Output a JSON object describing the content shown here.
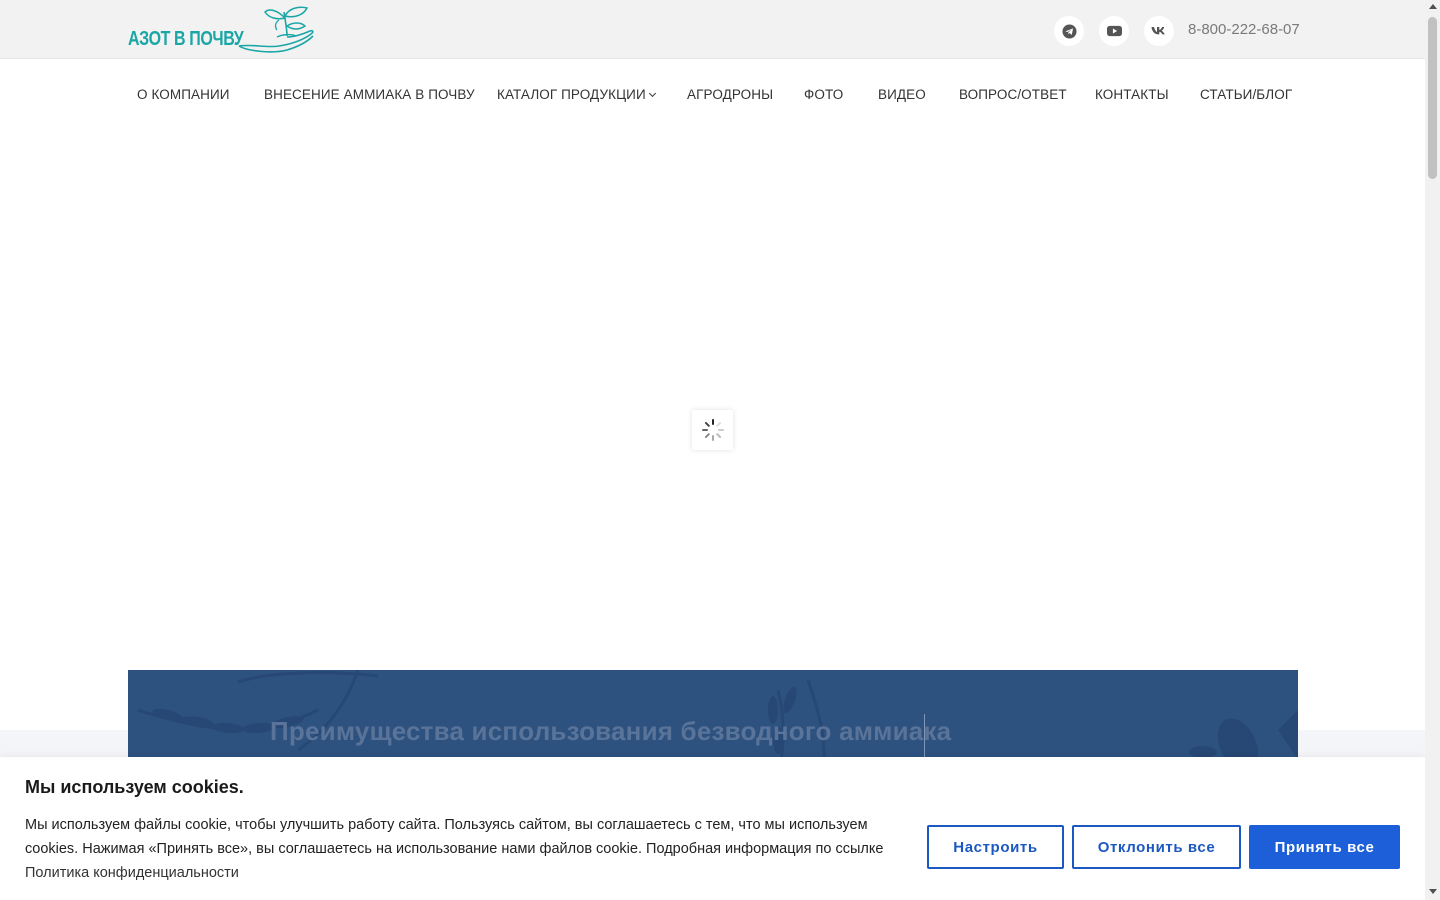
{
  "header": {
    "logo_text": "АЗОТ В ПОЧВУ",
    "social_icons": [
      "telegram-icon",
      "youtube-icon",
      "vk-icon"
    ],
    "phone": "8-800-222-68-07"
  },
  "nav": {
    "items": [
      {
        "label": "О КОМПАНИИ"
      },
      {
        "label": "ВНЕСЕНИЕ АММИАКА В ПОЧВУ"
      },
      {
        "label": "КАТАЛОГ ПРОДУКЦИИ"
      },
      {
        "label": "АГРОДРОНЫ"
      },
      {
        "label": "ФОТО"
      },
      {
        "label": "ВИДЕО"
      },
      {
        "label": "ВОПРОС/ОТВЕТ"
      },
      {
        "label": "КОНТАКТЫ"
      },
      {
        "label": "СТАТЬИ/БЛОГ"
      }
    ]
  },
  "banner": {
    "title": "Преимущества использования безводного аммиака"
  },
  "cookie": {
    "title": "Мы используем cookies.",
    "text": "Мы используем файлы cookie, чтобы улучшить работу сайта. Пользуясь сайтом, вы соглашаетесь с тем, что мы используем cookies. Нажимая «Принять все», вы соглашаетесь на использование нами файлов cookie. Подробная информация по ссылке ",
    "link_text": "Политика конфиденциальности",
    "buttons": {
      "settings": "Настроить",
      "reject": "Отклонить все",
      "accept": "Принять все"
    }
  },
  "colors": {
    "brand_teal": "#1ba6a6",
    "banner_blue": "#2e5280",
    "button_blue": "#1c5fd8"
  }
}
